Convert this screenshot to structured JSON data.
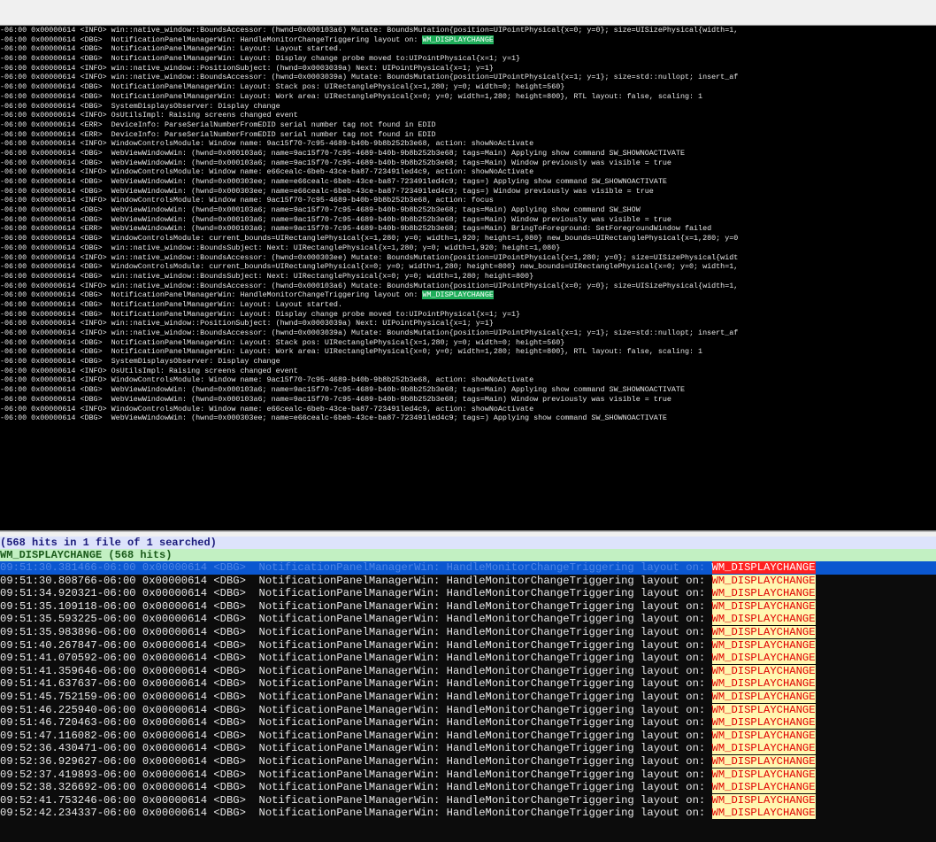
{
  "log_lines": [
    {
      "text": "-06:00 0x00000614 <INFO> win::native_window::BoundsAccessor: (hwnd=0x000103a6) Mutate: BoundsMutation{position=UIPointPhysical{x=0; y=0}; size=UISizePhysical{width=1,",
      "hl": ""
    },
    {
      "text": "-06:00 0x00000614 <DBG>  NotificationPanelManagerWin: HandleMonitorChangeTriggering layout on: ",
      "hl": "WM_DISPLAYCHANGE"
    },
    {
      "text": "-06:00 0x00000614 <DBG>  NotificationPanelManagerWin: Layout: Layout started.",
      "hl": ""
    },
    {
      "text": "-06:00 0x00000614 <DBG>  NotificationPanelManagerWin: Layout: Display change probe moved to:UIPointPhysical{x=1; y=1}",
      "hl": ""
    },
    {
      "text": "-06:00 0x00000614 <INFO> win::native_window::PositionSubject: (hwnd=0x0003039a) Next: UIPointPhysical{x=1; y=1}",
      "hl": ""
    },
    {
      "text": "-06:00 0x00000614 <INFO> win::native_window::BoundsAccessor: (hwnd=0x0003039a) Mutate: BoundsMutation{position=UIPointPhysical{x=1; y=1}; size=std::nullopt; insert_af",
      "hl": ""
    },
    {
      "text": "-06:00 0x00000614 <DBG>  NotificationPanelManagerWin: Layout: Stack pos: UIRectanglePhysical{x=1,280; y=0; width=0; height=560}",
      "hl": ""
    },
    {
      "text": "-06:00 0x00000614 <DBG>  NotificationPanelManagerWin: Layout: Work area: UIRectanglePhysical{x=0; y=0; width=1,280; height=800}, RTL layout: false, scaling: 1",
      "hl": ""
    },
    {
      "text": "-06:00 0x00000614 <DBG>  SystemDisplaysObserver: Display change",
      "hl": ""
    },
    {
      "text": "-06:00 0x00000614 <INFO> OsUtilsImpl: Raising screens changed event",
      "hl": ""
    },
    {
      "text": "-06:00 0x00000614 <ERR>  DeviceInfo: ParseSerialNumberFromEDID serial number tag not found in EDID",
      "hl": ""
    },
    {
      "text": "-06:00 0x00000614 <ERR>  DeviceInfo: ParseSerialNumberFromEDID serial number tag not found in EDID",
      "hl": ""
    },
    {
      "text": "-06:00 0x00000614 <INFO> WindowControlsModule: Window name: 9ac15f70-7c95-4689-b40b-9b8b252b3e68, action: showNoActivate",
      "hl": ""
    },
    {
      "text": "-06:00 0x00000614 <DBG>  WebViewWindowWin: (hwnd=0x000103a6; name=9ac15f70-7c95-4689-b40b-9b8b252b3e68; tags=Main) Applying show command SW_SHOWNOACTIVATE",
      "hl": ""
    },
    {
      "text": "-06:00 0x00000614 <DBG>  WebViewWindowWin: (hwnd=0x000103a6; name=9ac15f70-7c95-4689-b40b-9b8b252b3e68; tags=Main) Window previously was visible = true",
      "hl": ""
    },
    {
      "text": "-06:00 0x00000614 <INFO> WindowControlsModule: Window name: e66cealc-6beb-43ce-ba87-723491led4c9, action: showNoActivate",
      "hl": ""
    },
    {
      "text": "-06:00 0x00000614 <DBG>  WebViewWindowWin: (hwnd=0x000303ee; name=e66cealc-6beb-43ce-ba87-723491led4c9; tags=) Applying show command SW_SHOWNOACTIVATE",
      "hl": ""
    },
    {
      "text": "-06:00 0x00000614 <DBG>  WebViewWindowWin: (hwnd=0x000303ee; name=e66cealc-6beb-43ce-ba87-723491led4c9; tags=) Window previously was visible = true",
      "hl": ""
    },
    {
      "text": "-06:00 0x00000614 <INFO> WindowControlsModule: Window name: 9ac15f70-7c95-4689-b40b-9b8b252b3e68, action: focus",
      "hl": ""
    },
    {
      "text": "-06:00 0x00000614 <DBG>  WebViewWindowWin: (hwnd=0x000103a6; name=9ac15f70-7c95-4689-b40b-9b8b252b3e68; tags=Main) Applying show command SW_SHOW",
      "hl": ""
    },
    {
      "text": "-06:00 0x00000614 <DBG>  WebViewWindowWin: (hwnd=0x000103a6; name=9ac15f70-7c95-4689-b40b-9b8b252b3e68; tags=Main) Window previously was visible = true",
      "hl": ""
    },
    {
      "text": "-06:00 0x00000614 <ERR>  WebViewWindowWin: (hwnd=0x000103a6; name=9ac15f70-7c95-4689-b40b-9b8b252b3e68; tags=Main) BringToForeground: SetForegroundWindow failed",
      "hl": ""
    },
    {
      "text": "-06:00 0x00000614 <DBG>  WindowControlsModule: current_bounds=UIRectanglePhysical{x=1,280; y=0; width=1,920; height=1,080} new_bounds=UIRectanglePhysical{x=1,280; y=0",
      "hl": ""
    },
    {
      "text": "-06:00 0x00000614 <DBG>  win::native_window::BoundsSubject: Next: UIRectanglePhysical{x=1,280; y=0; width=1,920; height=1,080}",
      "hl": ""
    },
    {
      "text": "-06:00 0x00000614 <INFO> win::native_window::BoundsAccessor: (hwnd=0x000303ee) Mutate: BoundsMutation{position=UIPointPhysical{x=1,280; y=0}; size=UISizePhysical{widt",
      "hl": ""
    },
    {
      "text": "-06:00 0x00000614 <DBG>  WindowControlsModule: current_bounds=UIRectanglePhysical{x=0; y=0; width=1,280; height=800} new_bounds=UIRectanglePhysical{x=0; y=0; width=1,",
      "hl": ""
    },
    {
      "text": "-06:00 0x00000614 <DBG>  win::native_window::BoundsSubject: Next: UIRectanglePhysical{x=0; y=0; width=1,280; height=800}",
      "hl": ""
    },
    {
      "text": "-06:00 0x00000614 <INFO> win::native_window::BoundsAccessor: (hwnd=0x000103a6) Mutate: BoundsMutation{position=UIPointPhysical{x=0; y=0}; size=UISizePhysical{width=1,",
      "hl": ""
    },
    {
      "text": "-06:00 0x00000614 <DBG>  NotificationPanelManagerWin: HandleMonitorChangeTriggering layout on: ",
      "hl": "WM_DISPLAYCHANGE"
    },
    {
      "text": "-06:00 0x00000614 <DBG>  NotificationPanelManagerWin: Layout: Layout started.",
      "hl": ""
    },
    {
      "text": "-06:00 0x00000614 <DBG>  NotificationPanelManagerWin: Layout: Display change probe moved to:UIPointPhysical{x=1; y=1}",
      "hl": ""
    },
    {
      "text": "-06:00 0x00000614 <INFO> win::native_window::PositionSubject: (hwnd=0x0003039a) Next: UIPointPhysical{x=1; y=1}",
      "hl": ""
    },
    {
      "text": "-06:00 0x00000614 <INFO> win::native_window::BoundsAccessor: (hwnd=0x0003039a) Mutate: BoundsMutation{position=UIPointPhysical{x=1; y=1}; size=std::nullopt; insert_af",
      "hl": ""
    },
    {
      "text": "-06:00 0x00000614 <DBG>  NotificationPanelManagerWin: Layout: Stack pos: UIRectanglePhysical{x=1,280; y=0; width=0; height=560}",
      "hl": ""
    },
    {
      "text": "-06:00 0x00000614 <DBG>  NotificationPanelManagerWin: Layout: Work area: UIRectanglePhysical{x=0; y=0; width=1,280; height=800}, RTL layout: false, scaling: 1",
      "hl": ""
    },
    {
      "text": "-06:00 0x00000614 <DBG>  SystemDisplaysObserver: Display change",
      "hl": ""
    },
    {
      "text": "-06:00 0x00000614 <INFO> OsUtilsImpl: Raising screens changed event",
      "hl": ""
    },
    {
      "text": "-06:00 0x00000614 <INFO> WindowControlsModule: Window name: 9ac15f70-7c95-4689-b40b-9b8b252b3e68, action: showNoActivate",
      "hl": ""
    },
    {
      "text": "-06:00 0x00000614 <DBG>  WebViewWindowWin: (hwnd=0x000103a6; name=9ac15f70-7c95-4689-b40b-9b8b252b3e68; tags=Main) Applying show command SW_SHOWNOACTIVATE",
      "hl": ""
    },
    {
      "text": "-06:00 0x00000614 <DBG>  WebViewWindowWin: (hwnd=0x000103a6; name=9ac15f70-7c95-4689-b40b-9b8b252b3e68; tags=Main) Window previously was visible = true",
      "hl": ""
    },
    {
      "text": "-06:00 0x00000614 <INFO> WindowControlsModule: Window name: e66cealc-6beb-43ce-ba87-723491led4c9, action: showNoActivate",
      "hl": ""
    },
    {
      "text": "-06:00 0x00000614 <DBG>  WebViewWindowWin: (hwnd=0x000303ee; name=e66cealc-6beb-43ce-ba87-723491led4c9; tags=) Applying show command SW_SHOWNOACTIVATE",
      "hl": ""
    }
  ],
  "search": {
    "summary": "(568 hits in 1 file of 1 searched)",
    "term_header": "WM_DISPLAYCHANGE (568 hits)",
    "term": "WM_DISPLAYCHANGE",
    "prefix_suffix": " 0x00000614 <DBG>  NotificationPanelManagerWin: HandleMonitorChangeTriggering layout on: ",
    "selected_prefix": "09:51:30.381466-06:00 0x00000614 <DBG>  NotificationPanelManagerWin: HandleMonitorChangeTriggering layout on: ",
    "hits": [
      "09:51:30.808766-06:00",
      "09:51:34.920321-06:00",
      "09:51:35.109118-06:00",
      "09:51:35.593225-06:00",
      "09:51:35.983896-06:00",
      "09:51:40.267847-06:00",
      "09:51:41.070592-06:00",
      "09:51:41.359646-06:00",
      "09:51:41.637637-06:00",
      "09:51:45.752159-06:00",
      "09:51:46.225940-06:00",
      "09:51:46.720463-06:00",
      "09:51:47.116082-06:00",
      "09:52:36.430471-06:00",
      "09:52:36.929627-06:00",
      "09:52:37.419893-06:00",
      "09:52:38.326692-06:00",
      "09:52:41.753246-06:00",
      "09:52:42.234337-06:00"
    ]
  }
}
